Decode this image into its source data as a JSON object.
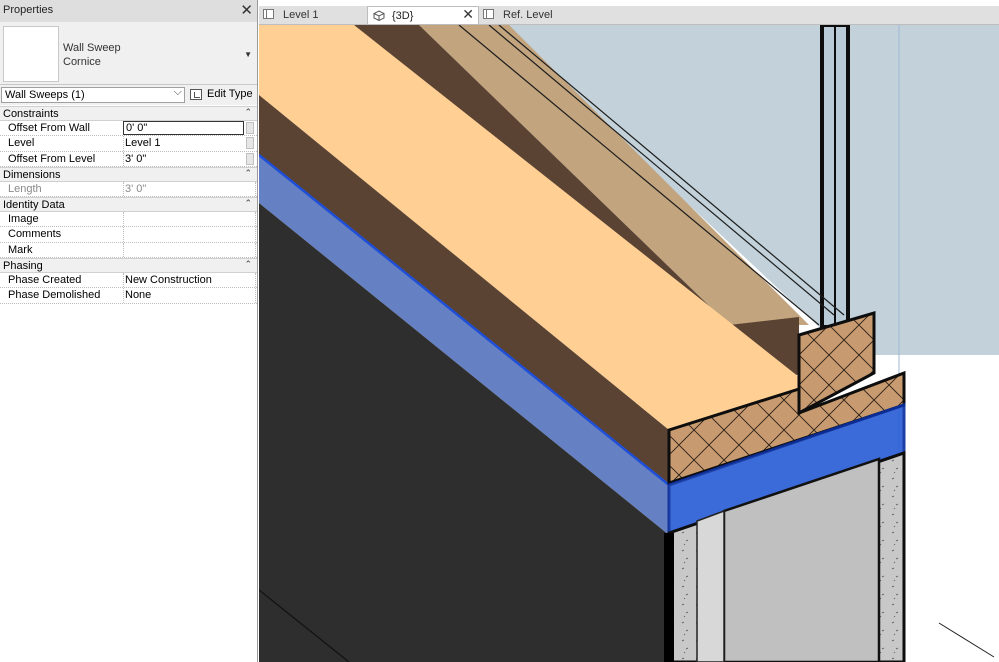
{
  "properties": {
    "title": "Properties",
    "close_label": "✕",
    "type_selector": {
      "family": "Wall Sweep",
      "type": "Cornice"
    },
    "instance_filter": "Wall Sweeps (1)",
    "edit_type_label": "Edit Type",
    "groups": [
      {
        "name": "Constraints",
        "rows": [
          {
            "key": "Offset From Wall",
            "value": "0'  0\""
          },
          {
            "key": "Level",
            "value": "Level 1"
          },
          {
            "key": "Offset From Level",
            "value": "3'  0\""
          }
        ]
      },
      {
        "name": "Dimensions",
        "rows": [
          {
            "key": "Length",
            "value": "3'  0\""
          }
        ]
      },
      {
        "name": "Identity Data",
        "rows": [
          {
            "key": "Image",
            "value": ""
          },
          {
            "key": "Comments",
            "value": ""
          },
          {
            "key": "Mark",
            "value": ""
          }
        ]
      },
      {
        "name": "Phasing",
        "rows": [
          {
            "key": "Phase Created",
            "value": "New Construction"
          },
          {
            "key": "Phase Demolished",
            "value": "None"
          }
        ]
      }
    ]
  },
  "tabs": [
    {
      "label": "Level 1",
      "icon": "floor-plan-icon",
      "active": false
    },
    {
      "label": "{3D}",
      "icon": "3d-cube-icon",
      "active": true
    },
    {
      "label": "Ref. Level",
      "icon": "floor-plan-icon",
      "active": false
    }
  ],
  "colors": {
    "wood": "#ffcf94",
    "dark_wood": "#5a4332",
    "glass": "#c3d2da",
    "highlight": "#2b5ed6",
    "wall": "#2e2e2e",
    "section_cut": "#c89a70",
    "concrete": "#c8c8c8"
  }
}
